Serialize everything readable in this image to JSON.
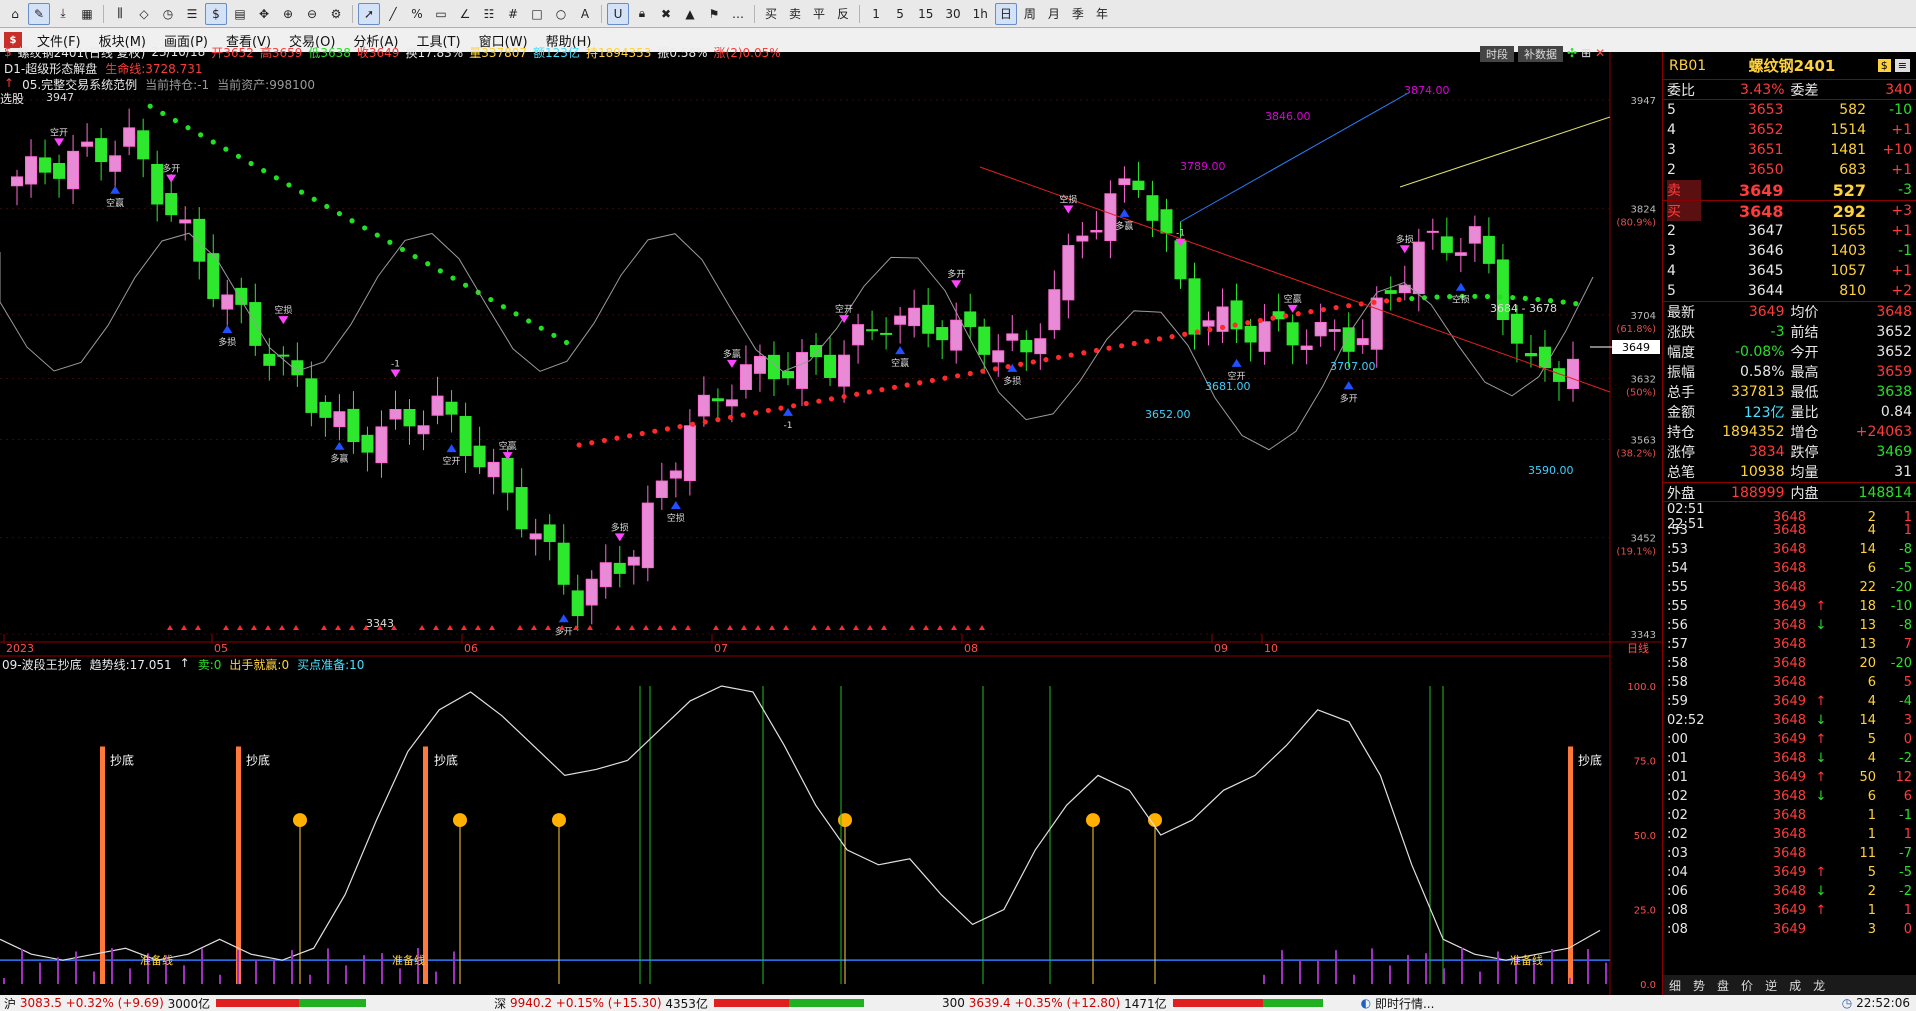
{
  "toolbar": {
    "buttons": [
      "home-icon",
      "edit-icon",
      "download-icon",
      "grid-icon",
      "bars-icon",
      "diamond-icon",
      "clock-icon",
      "list-icon",
      "dollar-icon",
      "grid2-icon",
      "move-icon",
      "zoom-in-icon",
      "zoom-out-icon",
      "gear-icon",
      "cursor-icon",
      "line-icon",
      "percent-icon",
      "rect-icon",
      "angle-icon",
      "hbar-icon",
      "hash-icon",
      "square-icon",
      "circle-icon",
      "text-icon",
      "magnet-icon",
      "lock-icon",
      "delete-icon",
      "marker-icon",
      "flag-icon",
      "more-icon"
    ],
    "trade_labels": [
      "买",
      "卖",
      "平",
      "反"
    ],
    "periods": [
      "1",
      "5",
      "15",
      "30",
      "1h",
      "日",
      "周",
      "月",
      "季",
      "年"
    ]
  },
  "menu": {
    "items": [
      "文件(F)",
      "板块(M)",
      "画面(P)",
      "查看(V)",
      "交易(O)",
      "分析(A)",
      "工具(T)",
      "窗口(W)",
      "帮助(H)"
    ]
  },
  "header": {
    "symbol": "螺纹钢2401(日线 复权)",
    "date": "23/10/18",
    "open": "开3652",
    "high": "高3659",
    "low": "低3638",
    "close": "收3649",
    "turnover": "换17.83%",
    "volume": "量337807",
    "amount": "额123亿",
    "hold": "持1894353",
    "amp": "振0.58%",
    "chg": "涨(2)0.05%",
    "indicator1": "D1-超级形态解盘",
    "indicator1_val": "生命线:3728.731",
    "indicator2": "05.完整交易系统范例",
    "pos": "当前持仓:-1",
    "asset": "当前资产:998100",
    "btn_period": "时段",
    "btn_adjust": "补数据",
    "select_label": "选股",
    "top_low": "3947"
  },
  "chart_data": {
    "type": "candlestick",
    "y_ticks": [
      "3947",
      "3824",
      "(80.9%)",
      "3704",
      "(61.8%)",
      "3632",
      "(50%)",
      "3563",
      "(38.2%)",
      "3452",
      "(19.1%)",
      "3343"
    ],
    "x_ticks": [
      "2023",
      "05",
      "06",
      "07",
      "08",
      "09",
      "10",
      "日线"
    ],
    "current_price": "3649",
    "annotations": [
      "3874.00",
      "3846.00",
      "3789.00",
      "3681.00",
      "3652.00",
      "3707.00",
      "3590.00",
      "3343",
      "3684 - 3678"
    ],
    "signals": [
      "空开",
      "空赢",
      "多开",
      "多损",
      "空损",
      "多赢",
      "-1"
    ]
  },
  "osc": {
    "title": "09-波段王抄底",
    "trend": "趋势线:17.051",
    "sell": "卖:0",
    "exit": "出手就赢:0",
    "buy_ready": "买点准备:10",
    "y_ticks": [
      "100.0",
      "75.0",
      "50.0",
      "25.0",
      "0.0"
    ],
    "label_chaodi": "抄底",
    "label_ready": "准备线"
  },
  "quote": {
    "code": "RB01",
    "name": "螺纹钢2401",
    "weibi_label": "委比",
    "weibi": "3.43%",
    "weicha_label": "委差",
    "weicha": "340",
    "asks": [
      {
        "lvl": "5",
        "price": "3653",
        "vol": "582",
        "chg": "-10"
      },
      {
        "lvl": "4",
        "price": "3652",
        "vol": "1514",
        "chg": "+1"
      },
      {
        "lvl": "3",
        "price": "3651",
        "vol": "1481",
        "chg": "+10"
      },
      {
        "lvl": "2",
        "price": "3650",
        "vol": "683",
        "chg": "+1"
      },
      {
        "lvl": "卖",
        "price": "3649",
        "vol": "527",
        "chg": "-3"
      }
    ],
    "bids": [
      {
        "lvl": "买",
        "price": "3648",
        "vol": "292",
        "chg": "+3"
      },
      {
        "lvl": "2",
        "price": "3647",
        "vol": "1565",
        "chg": "+1"
      },
      {
        "lvl": "3",
        "price": "3646",
        "vol": "1403",
        "chg": "-1"
      },
      {
        "lvl": "4",
        "price": "3645",
        "vol": "1057",
        "chg": "+1"
      },
      {
        "lvl": "5",
        "price": "3644",
        "vol": "810",
        "chg": "+2"
      }
    ],
    "stats": [
      [
        "最新",
        "3649",
        "均价",
        "3648"
      ],
      [
        "涨跌",
        "-3",
        "前结",
        "3652"
      ],
      [
        "幅度",
        "-0.08%",
        "今开",
        "3652"
      ],
      [
        "振幅",
        "0.58%",
        "最高",
        "3659"
      ],
      [
        "总手",
        "337813",
        "最低",
        "3638"
      ],
      [
        "金额",
        "123亿",
        "量比",
        "0.84"
      ],
      [
        "持仓",
        "1894352",
        "增仓",
        "+24063"
      ],
      [
        "涨停",
        "3834",
        "跌停",
        "3469"
      ],
      [
        "总笔",
        "10938",
        "均量",
        "31"
      ]
    ],
    "outer_label": "外盘",
    "outer": "188999",
    "inner_label": "内盘",
    "inner": "148814",
    "ticks": [
      [
        "02:51 22:51",
        "3648",
        "",
        "2",
        "1"
      ],
      [
        ":53",
        "3648",
        "",
        "4",
        "1"
      ],
      [
        ":53",
        "3648",
        "",
        "14",
        "-8"
      ],
      [
        ":54",
        "3648",
        "",
        "6",
        "-5"
      ],
      [
        ":55",
        "3648",
        "",
        "22",
        "-20"
      ],
      [
        ":55",
        "3649",
        "↑",
        "18",
        "-10"
      ],
      [
        ":56",
        "3648",
        "↓",
        "13",
        "-8"
      ],
      [
        ":57",
        "3648",
        "",
        "13",
        "7"
      ],
      [
        ":58",
        "3648",
        "",
        "20",
        "-20"
      ],
      [
        ":58",
        "3648",
        "",
        "6",
        "5"
      ],
      [
        ":59",
        "3649",
        "↑",
        "4",
        "-4"
      ],
      [
        "02:52",
        "3648",
        "↓",
        "14",
        "3"
      ],
      [
        ":00",
        "3649",
        "↑",
        "5",
        "0"
      ],
      [
        ":01",
        "3648",
        "↓",
        "4",
        "-2"
      ],
      [
        ":01",
        "3649",
        "↑",
        "50",
        "12"
      ],
      [
        ":02",
        "3648",
        "↓",
        "6",
        "6"
      ],
      [
        ":02",
        "3648",
        "",
        "1",
        "-1"
      ],
      [
        ":02",
        "3648",
        "",
        "1",
        "1"
      ],
      [
        ":03",
        "3648",
        "",
        "11",
        "-7"
      ],
      [
        ":04",
        "3649",
        "↑",
        "5",
        "-5"
      ],
      [
        ":06",
        "3648",
        "↓",
        "2",
        "-2"
      ],
      [
        ":08",
        "3649",
        "↑",
        "1",
        "1"
      ],
      [
        ":08",
        "3649",
        "",
        "3",
        "0"
      ]
    ],
    "tabs": [
      "细",
      "势",
      "盘",
      "价",
      "逆",
      "成",
      "龙"
    ]
  },
  "status": {
    "sh_label": "沪",
    "sh": "3083.5 +0.32% (+9.69)",
    "sh_amt": "3000亿",
    "sz_label": "深",
    "sz": "9940.2 +0.15% (+15.30)",
    "sz_amt": "4353亿",
    "hs_label": "300",
    "hs": "3639.4 +0.35% (+12.80)",
    "hs_amt": "1471亿",
    "news": "即时行情...",
    "time": "22:52:06"
  }
}
